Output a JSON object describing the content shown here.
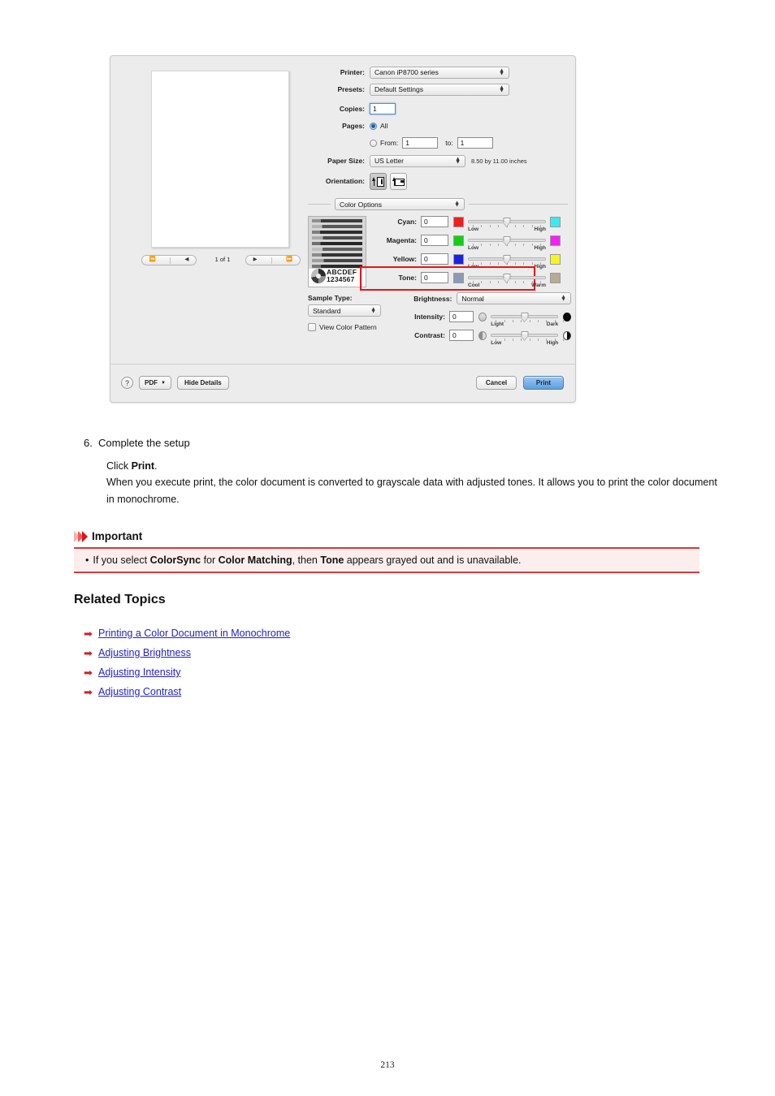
{
  "dialog": {
    "printer": {
      "label": "Printer:",
      "value": "Canon iP8700 series"
    },
    "presets": {
      "label": "Presets:",
      "value": "Default Settings"
    },
    "copies": {
      "label": "Copies:",
      "value": "1"
    },
    "pages": {
      "label": "Pages:",
      "all_label": "All",
      "from_label": "From:",
      "from_value": "1",
      "to_label": "to:",
      "to_value": "1"
    },
    "paper_size": {
      "label": "Paper Size:",
      "value": "US Letter",
      "note": "8.50 by 11.00 inches"
    },
    "orientation": {
      "label": "Orientation:"
    },
    "pane": {
      "value": "Color Options"
    },
    "preview": {
      "pager_label": "1 of 1"
    },
    "sample": {
      "abc": "ABCDEF",
      "num": "1234567"
    },
    "sliders": [
      {
        "name": "cyan",
        "label": "Cyan:",
        "value": "0",
        "low": "Low",
        "high": "High",
        "left_color": "#f01f1f",
        "right_color": "#3de8ef"
      },
      {
        "name": "magenta",
        "label": "Magenta:",
        "value": "0",
        "low": "Low",
        "high": "High",
        "left_color": "#17cc17",
        "right_color": "#f520f5"
      },
      {
        "name": "yellow",
        "label": "Yellow:",
        "value": "0",
        "low": "Low",
        "high": "High",
        "left_color": "#1a23e0",
        "right_color": "#f5f520"
      },
      {
        "name": "tone",
        "label": "Tone:",
        "value": "0",
        "low": "Cool",
        "high": "Warm",
        "left_color": "#8b9bb5",
        "right_color": "#b7ab96"
      }
    ],
    "sample_type": {
      "label": "Sample Type:",
      "value": "Standard"
    },
    "view_color_pattern": {
      "label": "View Color Pattern",
      "checked": false
    },
    "brightness": {
      "label": "Brightness:",
      "value": "Normal"
    },
    "intensity": {
      "label": "Intensity:",
      "value": "0",
      "low": "Light",
      "high": "Dark"
    },
    "contrast": {
      "label": "Contrast:",
      "value": "0",
      "low": "Low",
      "high": "High"
    },
    "footer": {
      "help": "?",
      "pdf": "PDF",
      "hide_details": "Hide Details",
      "cancel": "Cancel",
      "print": "Print"
    },
    "highlight_color": "#ee1111"
  },
  "step": {
    "number": "6.",
    "title": "Complete the setup",
    "line1_prefix": "Click ",
    "line1_bold": "Print",
    "line1_suffix": ".",
    "line2": "When you execute print, the color document is converted to grayscale data with adjusted tones. It allows you to print the color document in monochrome."
  },
  "important": {
    "title": "Important",
    "bullet": "•",
    "text_1": "If you select ",
    "bold_1": "ColorSync",
    "text_2": " for ",
    "bold_2": "Color Matching",
    "text_3": ", then ",
    "bold_3": "Tone",
    "text_4": " appears grayed out and is unavailable.",
    "accent_color": "#d23c3c",
    "chevron_colors": [
      "#f8b0b0",
      "#f25a5a",
      "#e01414"
    ]
  },
  "related_topics": {
    "title": "Related Topics",
    "arrow": "➡",
    "links": [
      "Printing a Color Document in Monochrome",
      "Adjusting Brightness",
      "Adjusting Intensity",
      "Adjusting Contrast"
    ],
    "link_color": "#2222cc"
  },
  "page_number": "213"
}
